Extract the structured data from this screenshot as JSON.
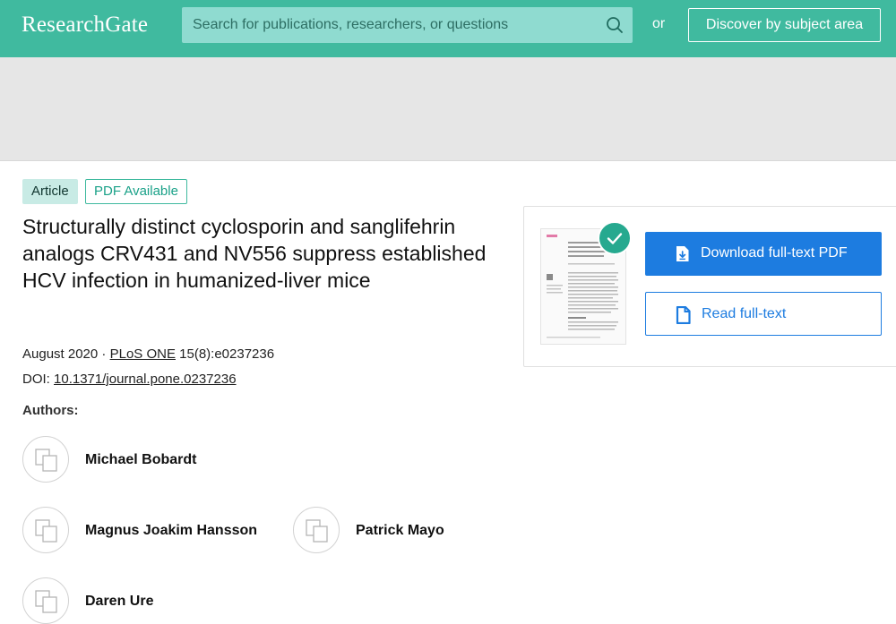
{
  "header": {
    "logo": "ResearchGate",
    "search_placeholder": "Search for publications, researchers, or questions",
    "or": "or",
    "discover_label": "Discover by subject area"
  },
  "badges": {
    "article": "Article",
    "pdf": "PDF Available"
  },
  "publication": {
    "title": "Structurally distinct cyclosporin and sanglifehrin analogs CRV431 and NV556 suppress established HCV infection in humanized-liver mice",
    "date": "August 2020",
    "separator": " · ",
    "journal": "PLoS ONE",
    "issue": " 15(8):e0237236",
    "doi_label": "DOI: ",
    "doi": "10.1371/journal.pone.0237236"
  },
  "authors_label": "Authors:",
  "authors": [
    "Michael Bobardt",
    "Magnus Joakim Hansson",
    "Patrick Mayo",
    "Daren Ure"
  ],
  "actions": {
    "download_label": "Download full-text PDF",
    "read_label": "Read full-text"
  },
  "colors": {
    "brand": "#40ba9f",
    "primary_button": "#1d7ce0",
    "banner": "#e6e6e6"
  },
  "icons": [
    "search-icon",
    "avatar-placeholder-icon",
    "checkmark-icon",
    "pdf-download-icon",
    "document-icon"
  ]
}
